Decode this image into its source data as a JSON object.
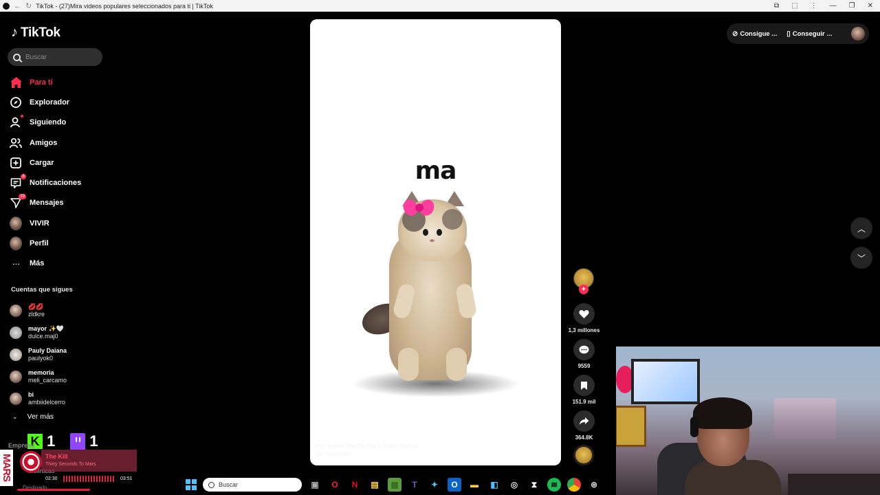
{
  "browser": {
    "title": "TikTok - (27)Mira videos populares seleccionados para ti | TikTok"
  },
  "sidebar": {
    "logo": "TikTok",
    "search_placeholder": "Buscar",
    "nav": [
      {
        "label": "Para ti",
        "icon": "home-icon",
        "active": true
      },
      {
        "label": "Explorador",
        "icon": "compass-icon"
      },
      {
        "label": "Siguiendo",
        "icon": "following-icon"
      },
      {
        "label": "Amigos",
        "icon": "friends-icon"
      },
      {
        "label": "Cargar",
        "icon": "upload-icon"
      },
      {
        "label": "Notificaciones",
        "icon": "notifications-icon",
        "badge": "8"
      },
      {
        "label": "Mensajes",
        "icon": "messages-icon",
        "badge": "19"
      },
      {
        "label": "VIVIR",
        "icon": "live-avatar"
      },
      {
        "label": "Perfil",
        "icon": "profile-avatar"
      },
      {
        "label": "Más",
        "icon": "more-icon"
      }
    ],
    "following_title": "Cuentas que sigues",
    "following": [
      {
        "name": "💋💋",
        "user": "zldkre"
      },
      {
        "name": "mayor ✨🤍",
        "user": "dulce.maj0"
      },
      {
        "name": "Pauly Daiana",
        "user": "paulyok0"
      },
      {
        "name": "memoria",
        "user": "meli_carcamo"
      },
      {
        "name": "bi",
        "user": "ambiidelcerro"
      }
    ],
    "see_more": "Ver más",
    "kick_count": "1",
    "twitch_count": "1",
    "empresa": "Empresa",
    "behind_text_1": "Dollrocas",
    "behind_text_2": "Desligado"
  },
  "music_widget": {
    "song": "The Kill",
    "artist": "Thirty Seconds To Mars",
    "album_strip": "MARS",
    "current_time": "02:30",
    "total_time": "03:51",
    "progress": 0.65
  },
  "video": {
    "caption": "ma",
    "hashtags": "#fyp #parati #michis #fypシ #gato #humor",
    "translate": "Ver traducción"
  },
  "actions": {
    "likes": "1,3 millones",
    "comments": "9559",
    "saves": "151.9 mil",
    "shares": "364.8K"
  },
  "topright": {
    "coins_label": "Consigue ...",
    "app_label": "Conseguir ..."
  },
  "taskbar": {
    "search_placeholder": "Buscar"
  },
  "colors": {
    "accent": "#fe2c55",
    "background": "#000000",
    "kick": "#53fc18",
    "twitch": "#9146ff"
  }
}
